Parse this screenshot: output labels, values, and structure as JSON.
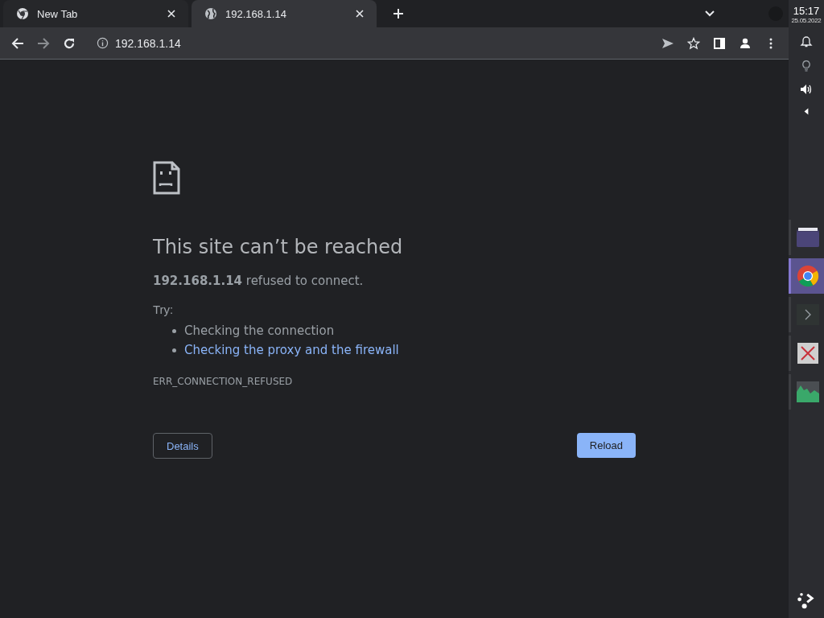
{
  "tabs": [
    {
      "title": "New Tab",
      "kind": "chrome",
      "selected": false
    },
    {
      "title": "192.168.1.14",
      "kind": "globe",
      "selected": true
    }
  ],
  "address": {
    "value": "192.168.1.14"
  },
  "error": {
    "title": "This site can’t be reached",
    "message": "**192.168.1.14** refused to connect.",
    "try_label": "Try:",
    "suggestions": [
      {
        "text": "Checking the connection",
        "kind": "text"
      },
      {
        "text": "Checking the proxy and the firewall",
        "kind": "link"
      }
    ],
    "code": "ERR_CONNECTION_REFUSED"
  },
  "buttons": {
    "details": "Details",
    "reload": "Reload"
  },
  "panel": {
    "time": "15:17",
    "date": "25.05.2022",
    "tasks": [
      {
        "kind": "folder",
        "selected": false
      },
      {
        "kind": "chrome",
        "selected": true
      },
      {
        "kind": "terminal",
        "selected": false
      },
      {
        "kind": "xkill",
        "selected": false
      },
      {
        "kind": "monitor",
        "selected": false
      }
    ]
  }
}
